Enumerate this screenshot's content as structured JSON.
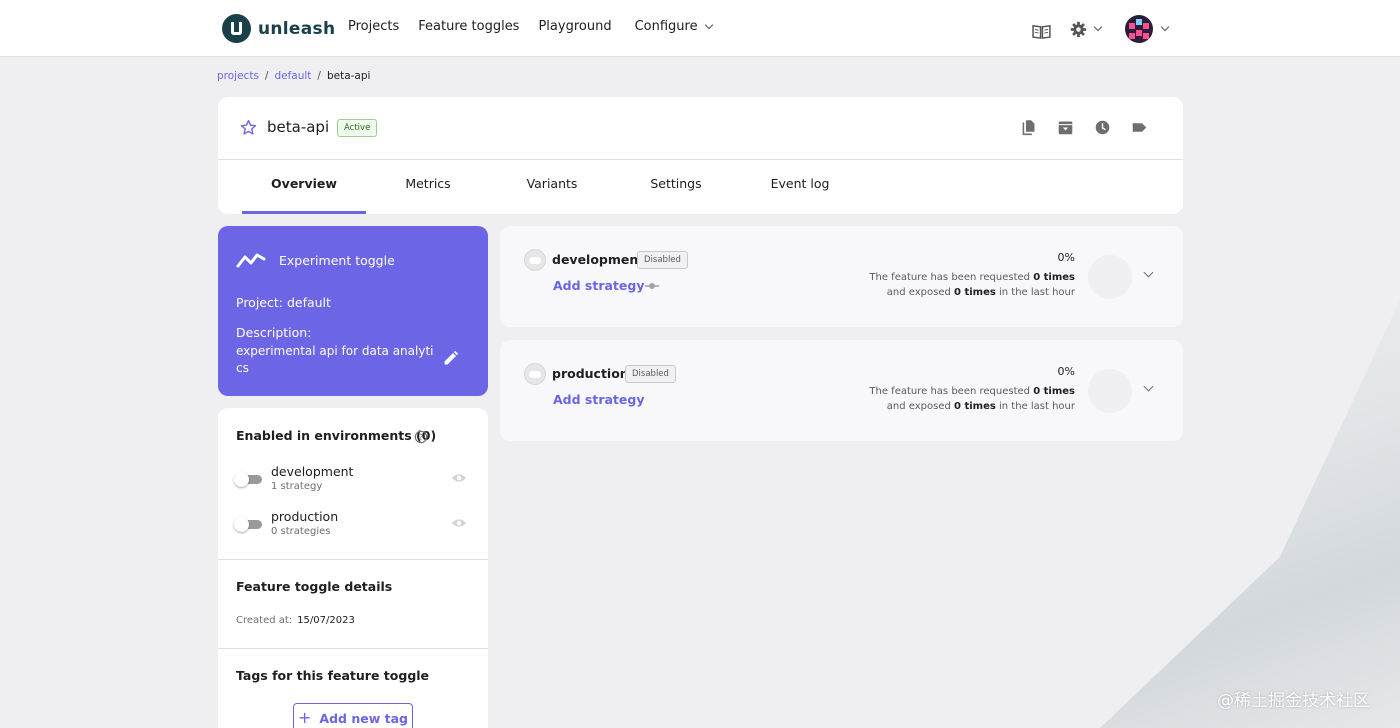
{
  "app": {
    "name": "unleash"
  },
  "nav": {
    "items": [
      "Projects",
      "Feature toggles",
      "Playground"
    ],
    "configure": "Configure"
  },
  "breadcrumbs": {
    "projects": "projects",
    "project": "default",
    "current": "beta-api"
  },
  "feature": {
    "name": "beta-api",
    "status": "Active",
    "tabs": [
      "Overview",
      "Metrics",
      "Variants",
      "Settings",
      "Event log"
    ],
    "active_tab": "Overview"
  },
  "summary": {
    "type_label": "Experiment toggle",
    "project": "Project: default",
    "description_label": "Description:",
    "description": "experimental api for data analytics"
  },
  "environments_panel": {
    "title": "Enabled in environments (0)",
    "items": [
      {
        "name": "development",
        "strategies": "1 strategy",
        "enabled": false
      },
      {
        "name": "production",
        "strategies": "0 strategies",
        "enabled": false
      }
    ]
  },
  "details": {
    "title": "Feature toggle details",
    "created_label": "Created at:",
    "created_value": "15/07/2023"
  },
  "tags": {
    "title": "Tags for this feature toggle",
    "add_button": "Add new tag"
  },
  "env_cards": [
    {
      "name": "development",
      "badge": "Disabled",
      "add_strategy": "Add strategy",
      "percent": "0%",
      "line1_prefix": "The feature has been requested ",
      "line1_bold": "0 times",
      "line2_prefix": "and exposed ",
      "line2_bold": "0 times",
      "line2_suffix": " in the last hour"
    },
    {
      "name": "production",
      "badge": "Disabled",
      "add_strategy": "Add strategy",
      "percent": "0%",
      "line1_prefix": "The feature has been requested ",
      "line1_bold": "0 times",
      "line2_prefix": "and exposed ",
      "line2_bold": "0 times",
      "line2_suffix": " in the last hour"
    }
  ],
  "watermark": "@稀土掘金技术社区",
  "colors": {
    "primary": "#6c65e5",
    "brand": "#1a4049",
    "active_badge": "#9bd08a"
  }
}
